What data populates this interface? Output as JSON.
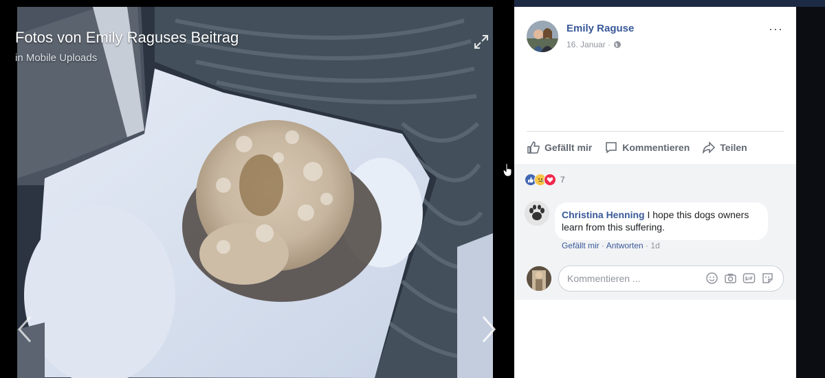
{
  "photo": {
    "title": "Fotos von Emily Raguses Beitrag",
    "album": "in Mobile Uploads"
  },
  "post": {
    "author": "Emily Raguse",
    "date": "16. Januar · ",
    "more_label": "···"
  },
  "actions": {
    "like": "Gefällt mir",
    "comment": "Kommentieren",
    "share": "Teilen"
  },
  "reactions": {
    "count": "7",
    "types": [
      "like",
      "sad",
      "love"
    ]
  },
  "comments": [
    {
      "author": "Christina Henning",
      "text": "I hope this dogs owners learn from this suffering.",
      "like_label": "Gefällt mir",
      "reply_label": "Antworten",
      "time": "1d"
    }
  ],
  "compose": {
    "placeholder": "Kommentieren ..."
  },
  "icons": [
    "expand-icon",
    "prev-arrow-icon",
    "next-arrow-icon",
    "globe-icon",
    "thumbs-up-icon",
    "comment-icon",
    "share-icon",
    "emoji-icon",
    "camera-icon",
    "gif-icon",
    "sticker-icon"
  ],
  "colors": {
    "link": "#385898",
    "muted": "#90949c",
    "panel_bg": "#f2f3f5",
    "like_blue": "#4267b2"
  }
}
